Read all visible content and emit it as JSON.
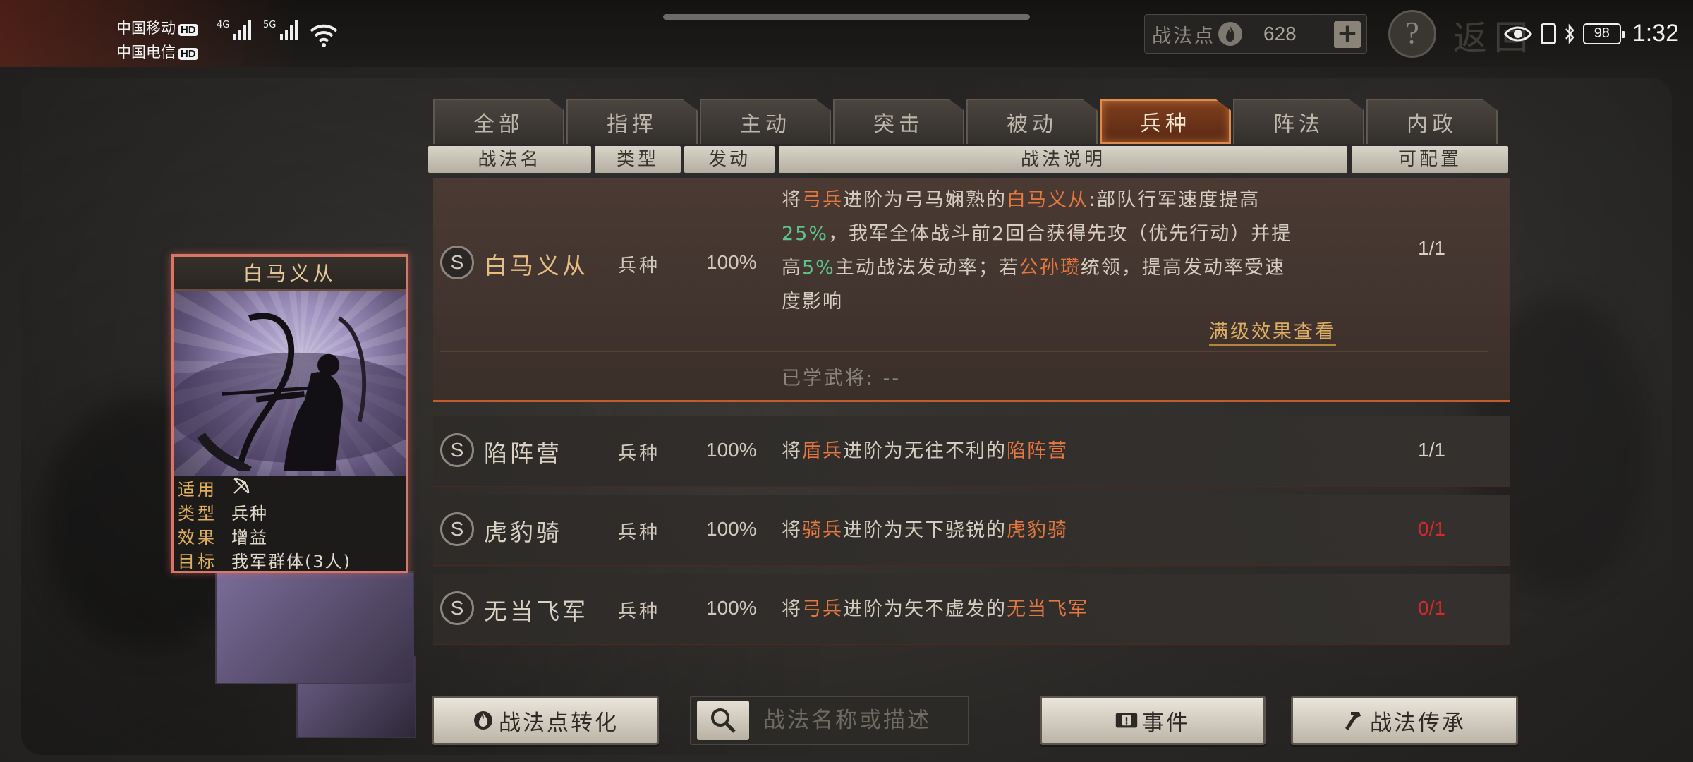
{
  "status_bar": {
    "carrier1": "中国移动",
    "carrier2": "中国电信",
    "hd": "HD",
    "net1": "4G",
    "net2": "5G",
    "battery": "98",
    "time": "1:32"
  },
  "top_bar": {
    "points_label": "战法点",
    "points_value": "628",
    "add_icon": "plus-icon",
    "help_label": "?",
    "back_label": "返回"
  },
  "tabs": [
    {
      "label": "全部",
      "active": false
    },
    {
      "label": "指挥",
      "active": false
    },
    {
      "label": "主动",
      "active": false
    },
    {
      "label": "突击",
      "active": false
    },
    {
      "label": "被动",
      "active": false
    },
    {
      "label": "兵种",
      "active": true
    },
    {
      "label": "阵法",
      "active": false
    },
    {
      "label": "内政",
      "active": false
    }
  ],
  "columns": {
    "name": "战法名",
    "type": "类型",
    "trigger": "发动",
    "desc": "战法说明",
    "config": "可配置"
  },
  "rows": [
    {
      "grade": "S",
      "name": "白马义从",
      "type": "兵种",
      "rate": "100%",
      "desc": {
        "l1a": "将",
        "l1b": "弓兵",
        "l1c": "进阶为弓马娴熟的",
        "l1d": "白马义从",
        "l1e": ":部队行军速度提高",
        "l2a": "25%",
        "l2b": "，我军全体战斗前2回合获得先攻（优先行动）并提",
        "l3a": "高",
        "l3b": "5%",
        "l3c": "主动战法发动率；若",
        "l3d": "公孙瓒",
        "l3e": "统领，提高发动率受速",
        "l4a": "度影响"
      },
      "config": "1/1",
      "full_link": "满级效果查看",
      "learned": "已学武将:  --"
    },
    {
      "grade": "S",
      "name": "陷阵营",
      "type": "兵种",
      "rate": "100%",
      "desc": {
        "a": "将",
        "b": "盾兵",
        "c": "进阶为无往不利的",
        "d": "陷阵营"
      },
      "config": "1/1"
    },
    {
      "grade": "S",
      "name": "虎豹骑",
      "type": "兵种",
      "rate": "100%",
      "desc": {
        "a": "将",
        "b": "骑兵",
        "c": "进阶为天下骁锐的",
        "d": "虎豹骑"
      },
      "config": "0/1"
    },
    {
      "grade": "S",
      "name": "无当飞军",
      "type": "兵种",
      "rate": "100%",
      "desc": {
        "a": "将",
        "b": "弓兵",
        "c": "进阶为矢不虚发的",
        "d": "无当飞军"
      },
      "config": "0/1"
    }
  ],
  "card": {
    "title": "白马义从",
    "k1": "适用",
    "v1_icon": "bow-icon",
    "k2": "类型",
    "v2": "兵种",
    "k3": "效果",
    "v3": "增益",
    "k4": "目标",
    "v4": "我军群体(3人)"
  },
  "bottom": {
    "convert_label": "战法点转化",
    "search_placeholder": "战法名称或描述",
    "event_label": "事件",
    "inherit_label": "战法传承"
  },
  "colors": {
    "highlight_orange": "#e2773f",
    "highlight_green": "#5fc38c",
    "config_red": "#d6292a",
    "active_tab": "#7e3f1e"
  }
}
